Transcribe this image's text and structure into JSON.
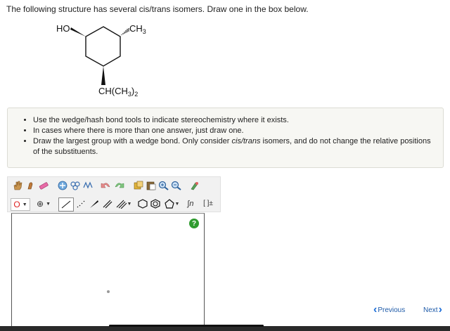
{
  "question": "The following structure has several cis/trans isomers. Draw one in the box below.",
  "structure": {
    "ho_label": "HO",
    "ch3_label": "CH",
    "ch3_sub": "3",
    "iso_label_a": "CH(CH",
    "iso_sub": "3",
    "iso_label_b": ")",
    "iso_sub2": "2"
  },
  "instructions": {
    "items": [
      "Use the wedge/hash bond tools to indicate stereochemistry where it exists.",
      "In cases where there is more than one answer, just draw one.",
      "Draw the largest group with a wedge bond. Only consider cis/trans isomers, and do not change the relative positions of the substituents."
    ],
    "emphasis": "cis/trans"
  },
  "toolbar": {
    "atom_label": "O",
    "charge_label": "⊕",
    "ring_label": "∫n",
    "bracket_label": "[ ]±"
  },
  "editor": {
    "help_label": "?"
  },
  "nav": {
    "previous_label": "Previous",
    "next_label": "Next"
  },
  "colors": {
    "link": "#1e5aa8",
    "help_green": "#2f9b2f",
    "instruction_bg": "#f7f7f3"
  }
}
